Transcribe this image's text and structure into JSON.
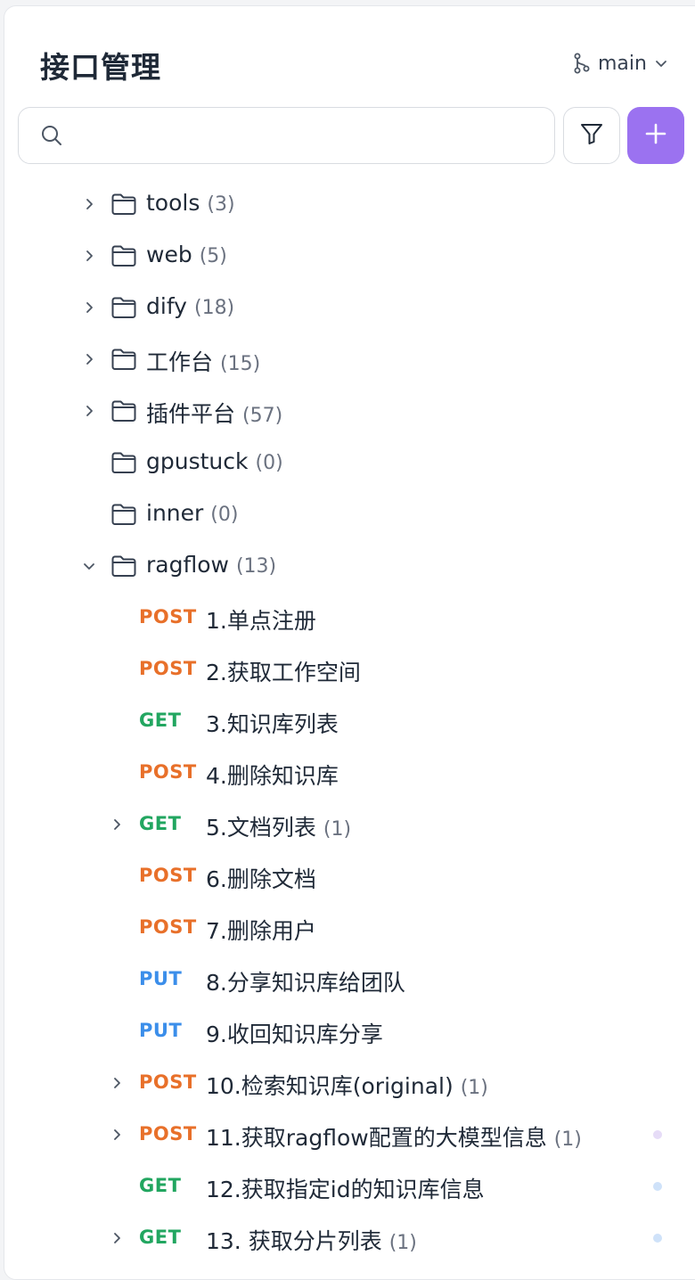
{
  "header": {
    "title": "接口管理",
    "branch": "main"
  },
  "search": {
    "placeholder": ""
  },
  "colors": {
    "accent": "#9b72f0",
    "post": "#e8702a",
    "get": "#22a660",
    "put": "#3b8eea"
  },
  "folders": [
    {
      "name": "tools",
      "count": "(3)",
      "expandable": true,
      "expanded": false
    },
    {
      "name": "web",
      "count": "(5)",
      "expandable": true,
      "expanded": false
    },
    {
      "name": "dify",
      "count": "(18)",
      "expandable": true,
      "expanded": false
    },
    {
      "name": "工作台",
      "count": "(15)",
      "expandable": true,
      "expanded": false
    },
    {
      "name": "插件平台",
      "count": "(57)",
      "expandable": true,
      "expanded": false
    },
    {
      "name": "gpustuck",
      "count": "(0)",
      "expandable": false,
      "expanded": false
    },
    {
      "name": "inner",
      "count": "(0)",
      "expandable": false,
      "expanded": false
    },
    {
      "name": "ragflow",
      "count": "(13)",
      "expandable": true,
      "expanded": true
    }
  ],
  "endpoints": [
    {
      "method": "POST",
      "name": "1.单点注册",
      "count": "",
      "expandable": false
    },
    {
      "method": "POST",
      "name": "2.获取工作空间",
      "count": "",
      "expandable": false
    },
    {
      "method": "GET",
      "name": "3.知识库列表",
      "count": "",
      "expandable": false
    },
    {
      "method": "POST",
      "name": "4.删除知识库",
      "count": "",
      "expandable": false
    },
    {
      "method": "GET",
      "name": "5.文档列表",
      "count": "(1)",
      "expandable": true
    },
    {
      "method": "POST",
      "name": "6.删除文档",
      "count": "",
      "expandable": false
    },
    {
      "method": "POST",
      "name": "7.删除用户",
      "count": "",
      "expandable": false
    },
    {
      "method": "PUT",
      "name": "8.分享知识库给团队",
      "count": "",
      "expandable": false
    },
    {
      "method": "PUT",
      "name": "9.收回知识库分享",
      "count": "",
      "expandable": false
    },
    {
      "method": "POST",
      "name": "10.检索知识库(original)",
      "count": "(1)",
      "expandable": true
    },
    {
      "method": "POST",
      "name": "11.获取ragflow配置的大模型信息",
      "count": "(1)",
      "expandable": true,
      "dot": "#e6dcf7"
    },
    {
      "method": "GET",
      "name": "12.获取指定id的知识库信息",
      "count": "",
      "expandable": false,
      "dot": "#cfe2f9"
    },
    {
      "method": "GET",
      "name": "13. 获取分片列表",
      "count": "(1)",
      "expandable": true,
      "dot": "#cfe2f9"
    }
  ]
}
